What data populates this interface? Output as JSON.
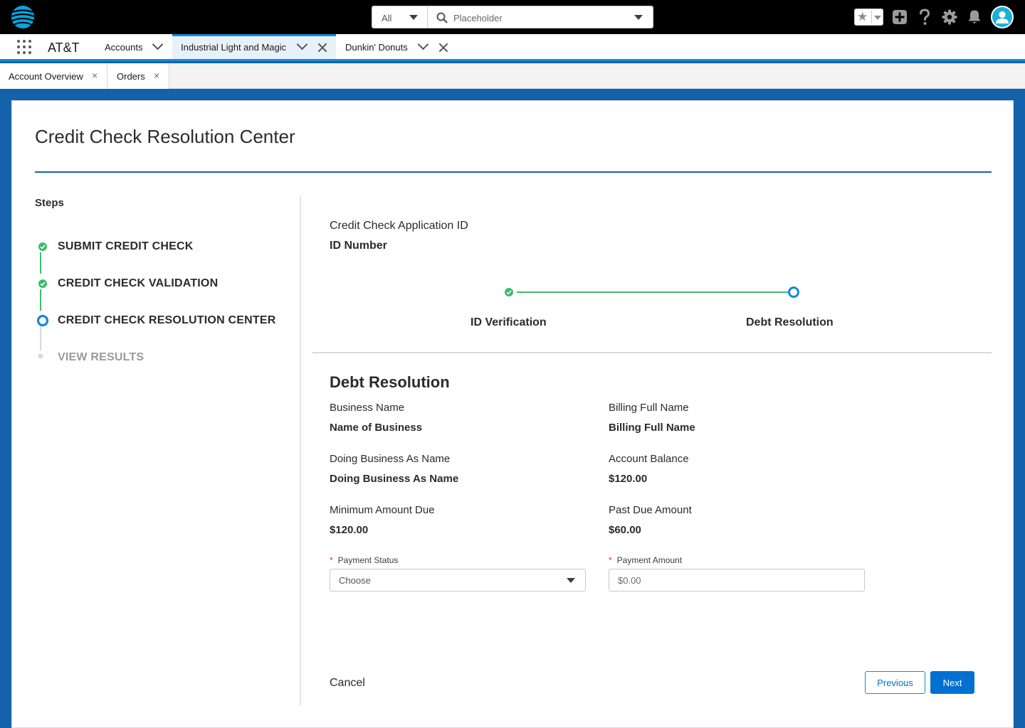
{
  "global_header": {
    "search_scope": "All",
    "search_placeholder": "Placeholder",
    "icons": [
      "att-logo-icon",
      "search-icon",
      "star-icon",
      "plus-icon",
      "help-icon",
      "gear-icon",
      "bell-icon",
      "user-avatar-icon"
    ]
  },
  "app": {
    "name": "AT&T",
    "tabs": [
      {
        "label": "Accounts"
      },
      {
        "label": "Industrial Light and Magic"
      },
      {
        "label": "Dunkin' Donuts"
      }
    ]
  },
  "subtabs": [
    {
      "label": "Account Overview",
      "close": "×"
    },
    {
      "label": "Orders",
      "close": "×"
    }
  ],
  "page": {
    "title": "Credit Check Resolution Center"
  },
  "steps": {
    "heading": "Steps",
    "items": [
      {
        "label": "SUBMIT CREDIT CHECK",
        "status": "complete"
      },
      {
        "label": "CREDIT CHECK VALIDATION",
        "status": "complete"
      },
      {
        "label": "CREDIT CHECK RESOLUTION CENTER",
        "status": "current"
      },
      {
        "label": "VIEW RESULTS",
        "status": "pending"
      }
    ]
  },
  "application": {
    "label": "Credit Check Application ID",
    "value": "ID Number"
  },
  "path": {
    "stages": [
      {
        "label": "ID Verification",
        "status": "complete"
      },
      {
        "label": "Debt Resolution",
        "status": "current"
      }
    ]
  },
  "debt_resolution": {
    "title": "Debt Resolution",
    "fields": {
      "business_name": {
        "label": "Business Name",
        "value": "Name of Business"
      },
      "billing_full_name": {
        "label": "Billing Full Name",
        "value": "Billing Full Name"
      },
      "dba_name": {
        "label": "Doing Business As Name",
        "value": "Doing Business As Name"
      },
      "account_balance": {
        "label": "Account Balance",
        "value": "$120.00"
      },
      "minimum_amount_due": {
        "label": "Minimum Amount Due",
        "value": "$120.00"
      },
      "past_due_amount": {
        "label": "Past Due Amount",
        "value": "$60.00"
      }
    },
    "payment_status": {
      "label": "Payment Status",
      "required_marker": "*",
      "selected": "Choose"
    },
    "payment_amount": {
      "label": "Payment Amount",
      "required_marker": "*",
      "placeholder": "$0.00"
    }
  },
  "footer": {
    "cancel": "Cancel",
    "previous": "Previous",
    "next": "Next"
  },
  "colors": {
    "brand_blue": "#1462ab",
    "accent_blue": "#1589d6",
    "button_blue": "#0070d2",
    "success_green": "#3bbd6f"
  }
}
